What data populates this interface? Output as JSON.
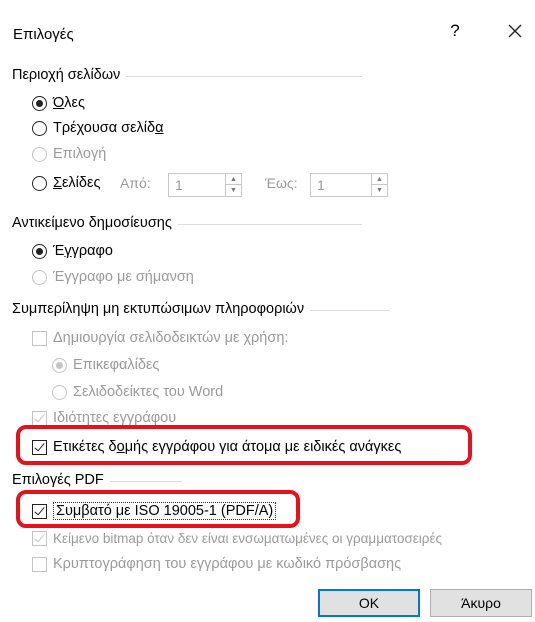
{
  "window": {
    "title": "Επιλογές",
    "help_label": "?"
  },
  "page_range": {
    "title": "Περιοχή σελίδων",
    "options": [
      {
        "label": "Όλες",
        "underline": "Ό",
        "selected": true,
        "enabled": true
      },
      {
        "label": "Τρέχουσα σελίδα",
        "underline": "α",
        "selected": false,
        "enabled": true
      },
      {
        "label": "Επιλογή",
        "selected": false,
        "enabled": false
      },
      {
        "label": "Σελίδες",
        "underline": "Σ",
        "selected": false,
        "enabled": true
      }
    ],
    "from_label": "Από:",
    "from_value": "1",
    "to_label": "Έως:",
    "to_value": "1"
  },
  "publish_what": {
    "title": "Αντικείμενο δημοσίευσης",
    "options": [
      {
        "label": "Έγγραφο",
        "underline": "γ",
        "selected": true,
        "enabled": true
      },
      {
        "label": "Έγγραφο με σήμανση",
        "selected": false,
        "enabled": false
      }
    ]
  },
  "non_printing": {
    "title": "Συμπερίληψη μη εκτυπώσιμων πληροφοριών",
    "create_bookmarks": {
      "label": "Δημιουργία σελιδοδεικτών με χρήση:",
      "checked": false,
      "enabled": false
    },
    "bookmark_sources": [
      {
        "label": "Επικεφαλίδες",
        "selected": true,
        "enabled": false
      },
      {
        "label": "Σελιδοδείκτες του Word",
        "selected": false,
        "enabled": false
      }
    ],
    "document_properties": {
      "label": "Ιδιότητες εγγράφου",
      "checked": true,
      "enabled": false
    },
    "structure_tags": {
      "label": "Ετικέτες δομής εγγράφου για άτομα με ειδικές ανάγκες",
      "underline": "ο",
      "checked": true,
      "enabled": true
    }
  },
  "pdf_options": {
    "title": "Επιλογές PDF",
    "iso_compliant": {
      "label": "Συμβατό με ISO 19005-1 (PDF/A)",
      "checked": true,
      "enabled": true
    },
    "bitmap_text": {
      "label": "Κείμενο bitmap όταν δεν είναι ενσωματωμένες οι γραμματοσειρές",
      "checked": true,
      "enabled": false
    },
    "encrypt": {
      "label": "Κρυπτογράφηση του εγγράφου με κωδικό πρόσβασης",
      "checked": false,
      "enabled": false
    }
  },
  "buttons": {
    "ok": "OK",
    "cancel": "Άκυρο"
  },
  "colors": {
    "highlight": "#e8101a",
    "default_button_border": "#0078d7",
    "disabled_text": "#9a9a9a"
  }
}
